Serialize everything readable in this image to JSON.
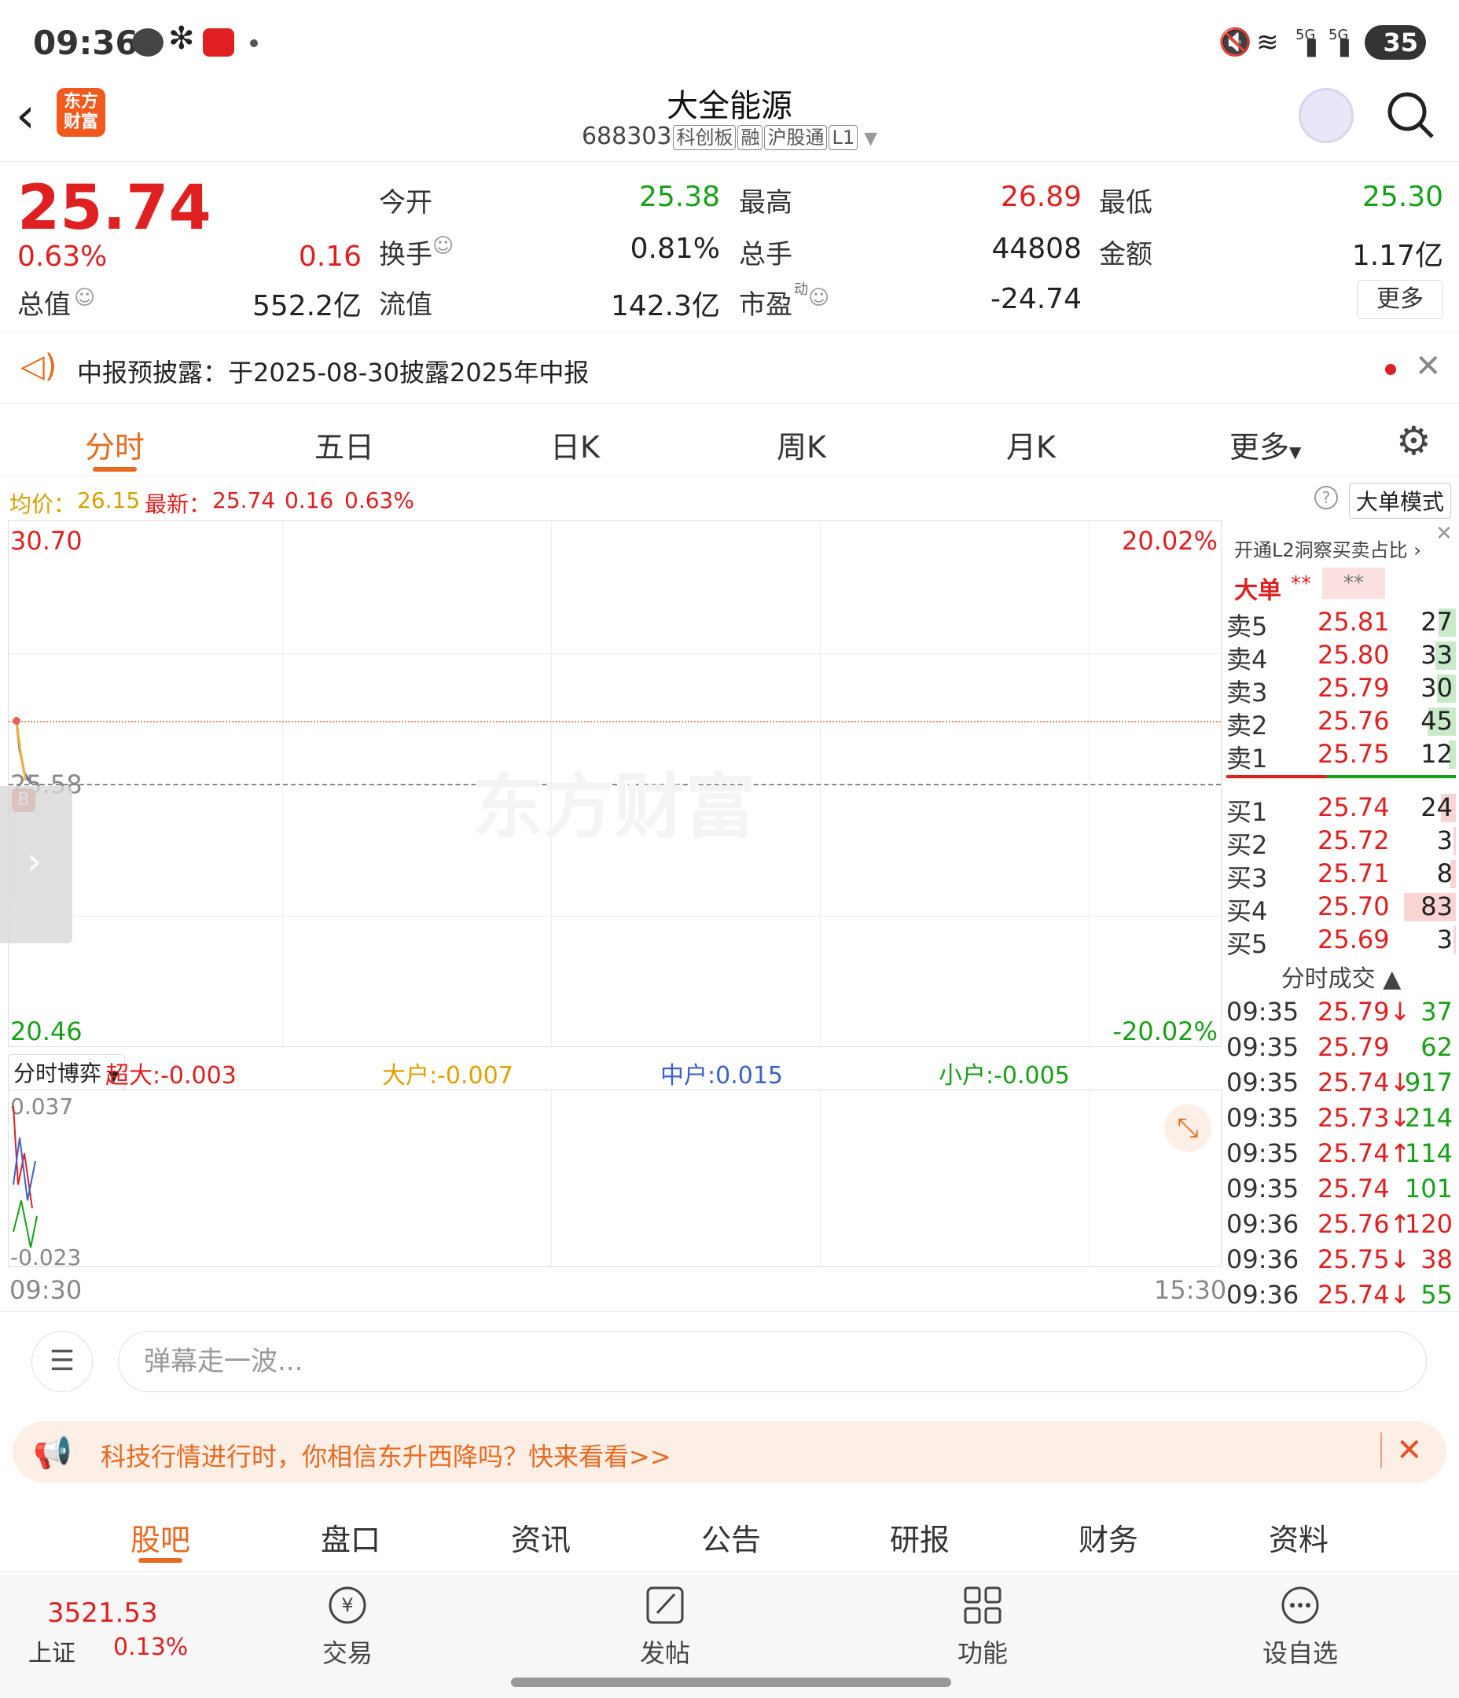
{
  "status": {
    "time": "09:36",
    "battery": "35",
    "net_a": "5G",
    "net_b": "5G"
  },
  "header": {
    "title": "大全能源",
    "code": "688303",
    "tags": [
      "科创板",
      "融",
      "沪股通",
      "L1"
    ],
    "logo_l1": "东方",
    "logo_l2": "财富"
  },
  "quote": {
    "price": "25.74",
    "change_pct": "0.63%",
    "change": "0.16",
    "total_mv_label": "总值",
    "total_mv": "552.2亿",
    "open_label": "今开",
    "open": "25.38",
    "high_label": "最高",
    "high": "26.89",
    "low_label": "最低",
    "low": "25.30",
    "turnover_label": "换手",
    "turnover": "0.81%",
    "volume_label": "总手",
    "volume": "44808",
    "amount_label": "金额",
    "amount": "1.17亿",
    "float_mv_label": "流值",
    "float_mv": "142.3亿",
    "pe_label": "市盈",
    "pe_sup": "动",
    "pe": "-24.74",
    "more": "更多"
  },
  "notice": {
    "text": "中报预披露：于2025-08-30披露2025年中报"
  },
  "tabs": [
    "分时",
    "五日",
    "日K",
    "周K",
    "月K",
    "更多"
  ],
  "avg": {
    "avg_label": "均价：",
    "avg": "26.15",
    "latest_label": "最新：",
    "latest": "25.74",
    "chg": "0.16",
    "pct": "0.63%",
    "big_mode": "大单模式"
  },
  "chart": {
    "max": "30.70",
    "min": "20.46",
    "mid": "25.58",
    "max_pct": "20.02%",
    "min_pct": "-20.02%",
    "start": "09:30",
    "end": "15:30",
    "watermark": "东方财富"
  },
  "flow": {
    "selector": "分时博弈",
    "super_label": "超大:-0.003",
    "big_label": "大户:-0.007",
    "mid_label": "中户:0.015",
    "small_label": "小户:-0.005",
    "top": "0.037",
    "bottom": "-0.023"
  },
  "book": {
    "l2_hint": "开通L2洞察买卖占比",
    "big_label": "大单",
    "big_a": "**",
    "big_b": "**",
    "asks": [
      {
        "l": "卖5",
        "p": "25.81",
        "q": "27",
        "w": 0.33
      },
      {
        "l": "卖4",
        "p": "25.80",
        "q": "33",
        "w": 0.4
      },
      {
        "l": "卖3",
        "p": "25.79",
        "q": "30",
        "w": 0.36
      },
      {
        "l": "卖2",
        "p": "25.76",
        "q": "45",
        "w": 0.54
      },
      {
        "l": "卖1",
        "p": "25.75",
        "q": "12",
        "w": 0.14
      }
    ],
    "bids": [
      {
        "l": "买1",
        "p": "25.74",
        "q": "24",
        "w": 0.29
      },
      {
        "l": "买2",
        "p": "25.72",
        "q": "3",
        "w": 0.04
      },
      {
        "l": "买3",
        "p": "25.71",
        "q": "8",
        "w": 0.1
      },
      {
        "l": "买4",
        "p": "25.70",
        "q": "83",
        "w": 1.0
      },
      {
        "l": "买5",
        "p": "25.69",
        "q": "3",
        "w": 0.04
      }
    ],
    "ticks_label": "分时成交",
    "ticks": [
      {
        "t": "09:35",
        "p": "25.79↓",
        "q": "37",
        "c": "green"
      },
      {
        "t": "09:35",
        "p": "25.79",
        "q": "62",
        "c": "green"
      },
      {
        "t": "09:35",
        "p": "25.74↓",
        "q": "917",
        "c": "green"
      },
      {
        "t": "09:35",
        "p": "25.73↓",
        "q": "214",
        "c": "green"
      },
      {
        "t": "09:35",
        "p": "25.74↑",
        "q": "114",
        "c": "green"
      },
      {
        "t": "09:35",
        "p": "25.74",
        "q": "101",
        "c": "green"
      },
      {
        "t": "09:36",
        "p": "25.76↑",
        "q": "120",
        "c": "red"
      },
      {
        "t": "09:36",
        "p": "25.75↓",
        "q": "38",
        "c": "red"
      },
      {
        "t": "09:36",
        "p": "25.74↓",
        "q": "55",
        "c": "green"
      }
    ]
  },
  "comment": {
    "placeholder": "弹幕走一波...",
    "dan": "弹"
  },
  "banner": {
    "text": "科技行情进行时，你相信东升西降吗？快来看看>>"
  },
  "bottom_tabs": [
    "股吧",
    "盘口",
    "资讯",
    "公告",
    "研报",
    "财务",
    "资料"
  ],
  "nav": {
    "index_value": "3521.53",
    "index_name": "上证",
    "index_pct": "0.13%",
    "trade": "交易",
    "post": "发帖",
    "func": "功能",
    "watch": "设自选"
  },
  "colors": {
    "up": "#e02020",
    "down": "#18a018",
    "accent": "#e86a1e"
  }
}
